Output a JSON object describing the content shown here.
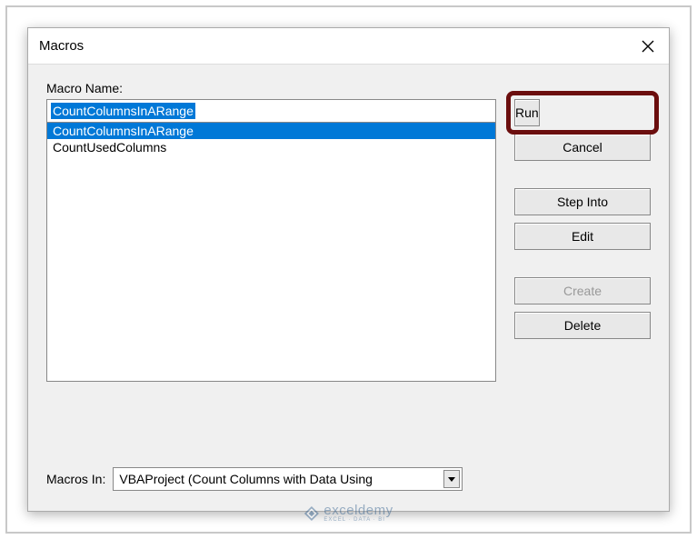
{
  "dialog": {
    "title": "Macros",
    "macro_name_label": "Macro Name:",
    "macro_name_value": "CountColumnsInARange",
    "macros_in_label": "Macros In:",
    "macros_in_value": "VBAProject (Count Columns with Data Using"
  },
  "macros": [
    {
      "name": "CountColumnsInARange",
      "selected": true
    },
    {
      "name": "CountUsedColumns",
      "selected": false
    }
  ],
  "buttons": {
    "run": "Run",
    "cancel": "Cancel",
    "step_into": "Step Into",
    "edit": "Edit",
    "create": "Create",
    "delete": "Delete"
  },
  "watermark": {
    "main": "exceldemy",
    "sub": "EXCEL · DATA · BI"
  }
}
